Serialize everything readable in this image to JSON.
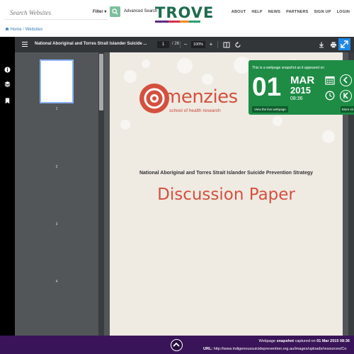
{
  "header": {
    "search_placeholder": "Search Websites",
    "filter_label": "Filter",
    "advanced_search": "Advanced Search",
    "logo_text": "TROVE",
    "nav": [
      "ABOUT",
      "HELP",
      "NEWS",
      "PARTNERS",
      "SIGN UP",
      "LOGIN"
    ]
  },
  "breadcrumb": {
    "home": "Home",
    "sep": "/",
    "current": "Websites"
  },
  "pdf": {
    "title": "National Aboriginal and Torres Strait Islander Suicide ...",
    "page_current": "1",
    "page_total": "/ 26",
    "zoom": "100%",
    "thumb_numbers": [
      "1",
      "2",
      "3",
      "4"
    ]
  },
  "document": {
    "logo_name": "menzies",
    "logo_sub": "school of health research",
    "title": "National Aboriginal and Torres Strait Islander Suicide Prevention Strategy",
    "heading": "Discussion Paper"
  },
  "snapshot": {
    "label": "This is a webpage snapshot as it appeared on",
    "day": "01",
    "month": "MAR",
    "year": "2015",
    "time": "08:36",
    "live_link": "View the live webpage",
    "more": "More sn"
  },
  "footer": {
    "line1_prefix": "Webpage",
    "line1_bold": "snapshot",
    "line1_mid": "captured on",
    "line1_date": "01 Mar 2015 08:36",
    "url_label": "URL:",
    "url": "http://www.indigenoussuicideprevention.org.au/images/uploads/resources/Co"
  },
  "colors": {
    "brand_green": "#1f6b4e",
    "badge_green": "#1e8c45",
    "footer_purple": "#3a1458",
    "menzies_red": "#d4503e",
    "accent_blue": "#1e88e5"
  }
}
